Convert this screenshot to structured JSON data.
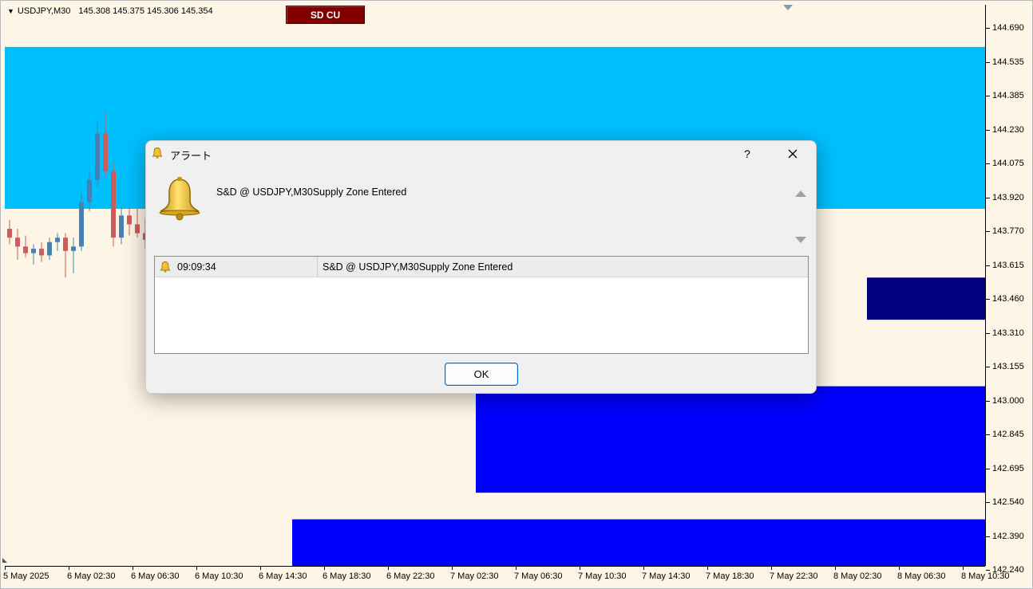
{
  "chart": {
    "symbol": "USDJPY,M30",
    "ohlc": "145.308 145.375 145.306 145.354",
    "sd_button_label": "SD CU",
    "price_axis_labels": [
      "144.690",
      "144.535",
      "144.385",
      "144.230",
      "144.075",
      "143.920",
      "143.770",
      "143.615",
      "143.460",
      "143.310",
      "143.155",
      "143.000",
      "142.845",
      "142.695",
      "142.540",
      "142.390",
      "142.240"
    ],
    "time_axis_labels": [
      "5 May 2025",
      "6 May 02:30",
      "6 May 06:30",
      "6 May 10:30",
      "6 May 14:30",
      "6 May 18:30",
      "6 May 22:30",
      "7 May 02:30",
      "7 May 06:30",
      "7 May 10:30",
      "7 May 14:30",
      "7 May 18:30",
      "7 May 22:30",
      "8 May 02:30",
      "8 May 06:30",
      "8 May 10:30"
    ],
    "colors": {
      "background": "#fdf5e6",
      "bull_candle": "#4682b4",
      "bear_candle": "#cd5c5c",
      "supply_zone": "#00bfff",
      "demand_zone": "#0000ff",
      "zone_dark": "#000080"
    }
  },
  "chart_data": {
    "type": "candlestick",
    "y_range": [
      142.24,
      144.77
    ],
    "zones": [
      {
        "color": "#00bfff",
        "top": 144.58,
        "bottom": 143.85
      },
      {
        "color": "#0000ff",
        "top": 143.05,
        "bottom": 142.57
      },
      {
        "color": "#0000ff",
        "top": 142.45,
        "bottom": 142.24
      },
      {
        "color": "#000080",
        "top": 143.54,
        "bottom": 143.35
      }
    ],
    "candles": [
      [
        143.76,
        143.8,
        143.69,
        143.72
      ],
      [
        143.72,
        143.76,
        143.62,
        143.68
      ],
      [
        143.68,
        143.73,
        143.63,
        143.65
      ],
      [
        143.65,
        143.69,
        143.6,
        143.67
      ],
      [
        143.67,
        143.7,
        143.61,
        143.64
      ],
      [
        143.64,
        143.72,
        143.62,
        143.7
      ],
      [
        143.7,
        143.74,
        143.66,
        143.72
      ],
      [
        143.72,
        143.74,
        143.54,
        143.66
      ],
      [
        143.66,
        143.72,
        143.56,
        143.68
      ],
      [
        143.68,
        143.92,
        143.66,
        143.88
      ],
      [
        143.88,
        144.02,
        143.84,
        143.98
      ],
      [
        143.98,
        144.25,
        143.95,
        144.19
      ],
      [
        144.19,
        144.29,
        143.99,
        144.02
      ],
      [
        144.02,
        144.06,
        143.68,
        143.72
      ],
      [
        143.72,
        143.86,
        143.69,
        143.82
      ],
      [
        143.82,
        143.86,
        143.73,
        143.78
      ],
      [
        143.78,
        143.85,
        143.72,
        143.74
      ],
      [
        143.74,
        143.81,
        143.67,
        143.71
      ]
    ]
  },
  "dialog": {
    "title": "アラート",
    "help_label": "?",
    "message": "S&D @ USDJPY,M30Supply Zone Entered",
    "list_time": "09:09:34",
    "list_message": "S&D @ USDJPY,M30Supply Zone Entered",
    "ok_label": "OK"
  }
}
